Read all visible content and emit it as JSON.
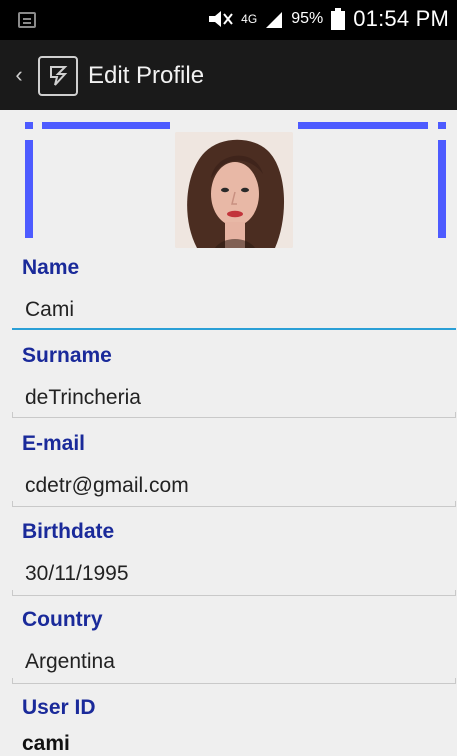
{
  "status_bar": {
    "battery_percent": "95%",
    "time": "01:54 PM",
    "network_type": "4G"
  },
  "action_bar": {
    "title": "Edit Profile"
  },
  "profile": {
    "fields": [
      {
        "label": "Name",
        "value": "Cami"
      },
      {
        "label": "Surname",
        "value": "deTrincheria"
      },
      {
        "label": "E-mail",
        "value": "cdetr@gmail.com"
      },
      {
        "label": "Birthdate",
        "value": "30/11/1995"
      },
      {
        "label": "Country",
        "value": "Argentina"
      }
    ],
    "user_id_label": "User ID",
    "user_id_value": "cami"
  },
  "colors": {
    "label_color": "#1a2a9a",
    "accent_line": "#4d5bff",
    "active_underline": "#2a9fd6"
  }
}
